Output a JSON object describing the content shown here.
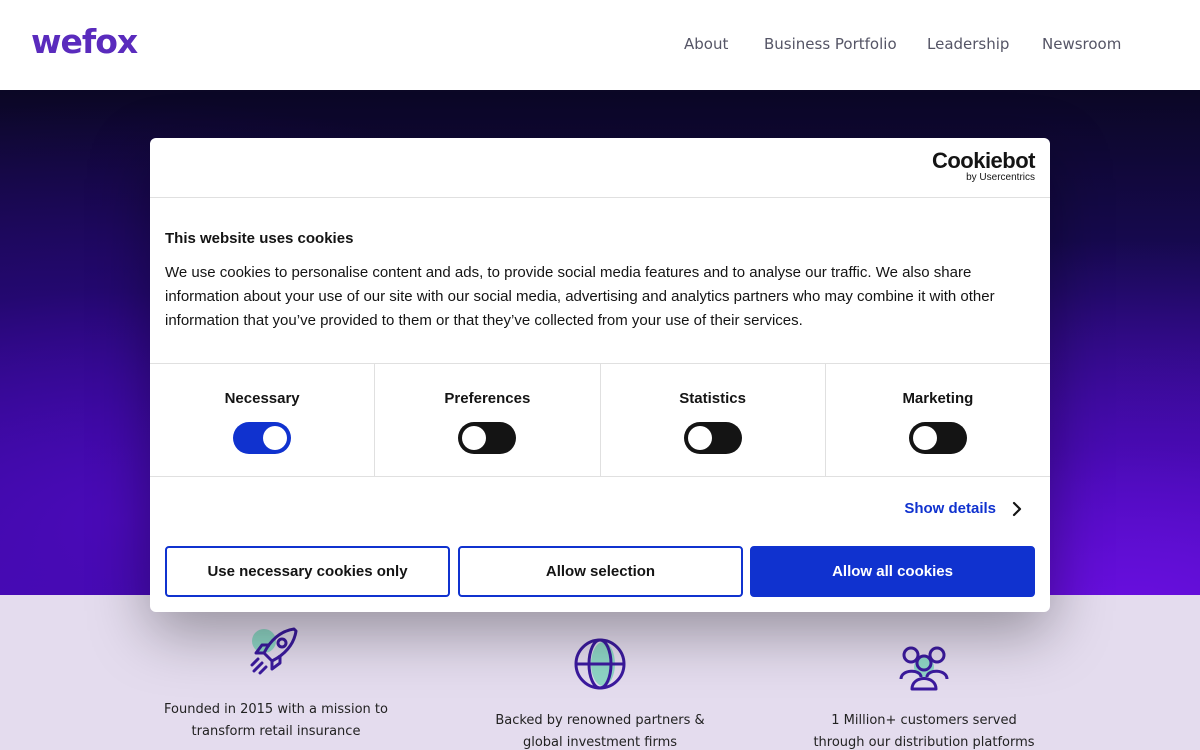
{
  "header": {
    "logo": "wefox",
    "nav": [
      "About",
      "Business Portfolio",
      "Leadership",
      "Newsroom"
    ]
  },
  "cookie_dialog": {
    "brand": "Cookiebot",
    "brand_sub": "by Usercentrics",
    "title": "This website uses cookies",
    "text": "We use cookies to personalise content and ads, to provide social media features and to analyse our traffic. We also share information about your use of our site with our social media, advertising and analytics partners who may combine it with other information that you’ve provided to them or that they’ve collected from your use of their services.",
    "categories": [
      {
        "label": "Necessary",
        "enabled": true
      },
      {
        "label": "Preferences",
        "enabled": false
      },
      {
        "label": "Statistics",
        "enabled": false
      },
      {
        "label": "Marketing",
        "enabled": false
      }
    ],
    "show_details": "Show details",
    "buttons": {
      "necessary_only": "Use necessary cookies only",
      "allow_selection": "Allow selection",
      "allow_all": "Allow all cookies"
    }
  },
  "stats": [
    {
      "icon": "rocket-icon",
      "line1": "Founded in 2015 with a mission to",
      "line2": "transform retail insurance"
    },
    {
      "icon": "globe-icon",
      "line1": "Backed by renowned partners &",
      "line2": "global investment firms"
    },
    {
      "icon": "people-icon",
      "line1": "1 Million+ customers served",
      "line2": "through our distribution platforms"
    }
  ],
  "colors": {
    "brand_purple": "#5a2bbd",
    "cookiebot_blue": "#1032cf",
    "stats_background": "#e4dcee"
  }
}
